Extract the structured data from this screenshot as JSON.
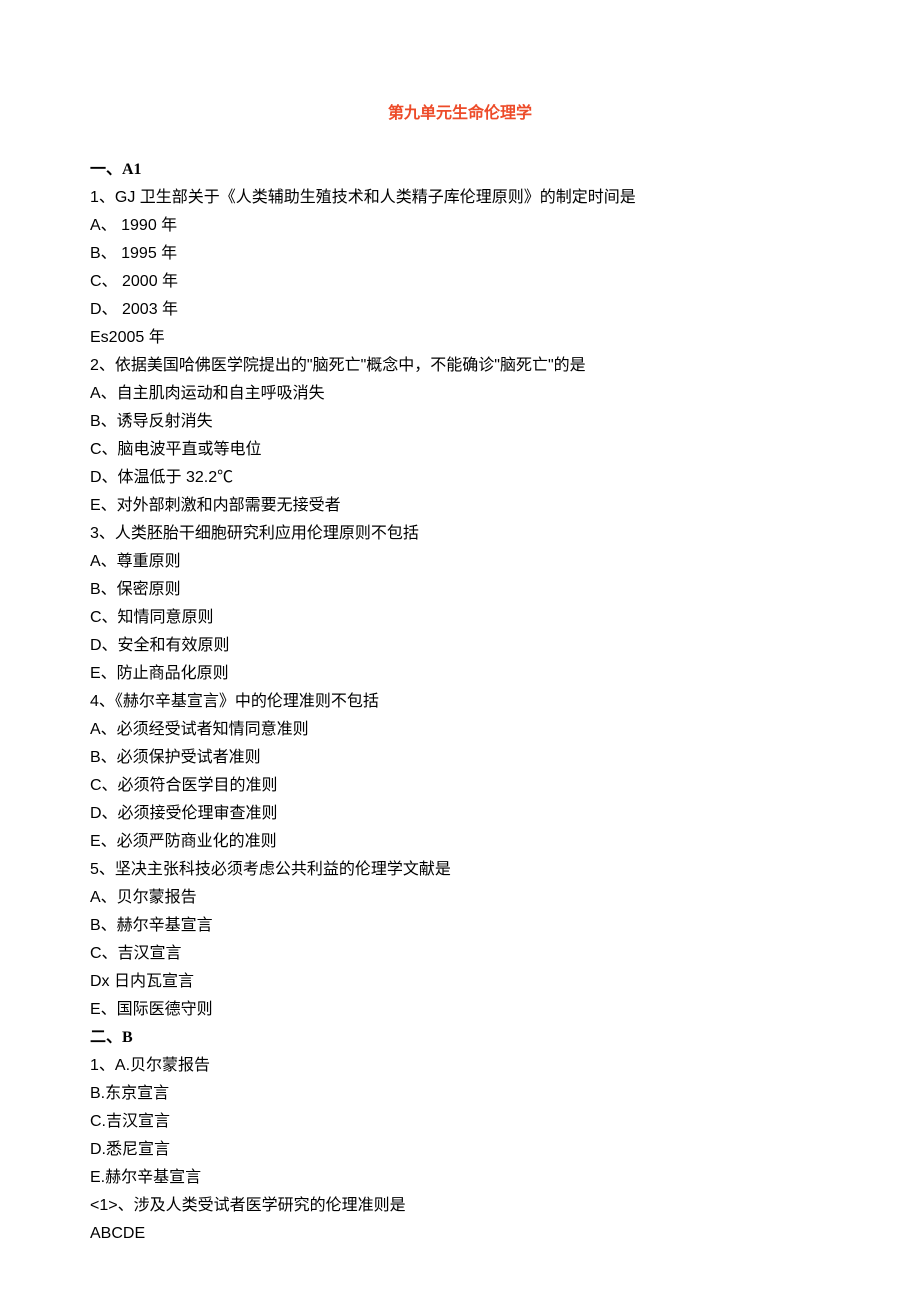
{
  "title": "第九单元生命伦理学",
  "sectionA": {
    "heading": "一、A1",
    "questions": [
      {
        "stem": "1、GJ 卫生部关于《人类辅助生殖技术和人类精子库伦理原则》的制定时间是",
        "options": [
          "A、 1990 年",
          "B、 1995 年",
          "C、 2000 年",
          "D、 2003 年",
          "Es2005 年"
        ]
      },
      {
        "stem": "2、依据美国哈佛医学院提出的\"脑死亡\"概念中，不能确诊\"脑死亡\"的是",
        "options": [
          "A、自主肌肉运动和自主呼吸消失",
          "B、诱导反射消失",
          "C、脑电波平直或等电位",
          "D、体温低于 32.2℃",
          "E、对外部刺激和内部需要无接受者"
        ]
      },
      {
        "stem": "3、人类胚胎干细胞研究利应用伦理原则不包括",
        "options": [
          "A、尊重原则",
          "B、保密原则",
          "C、知情同意原则",
          "D、安全和有效原则",
          "E、防止商品化原则"
        ]
      },
      {
        "stem": "4、《赫尔辛基宣言》中的伦理准则不包括",
        "options": [
          "A、必须经受试者知情同意准则",
          "B、必须保护受试者准则",
          "C、必须符合医学目的准则",
          "D、必须接受伦理审查准则",
          "E、必须严防商业化的准则"
        ]
      },
      {
        "stem": "5、坚决主张科技必须考虑公共利益的伦理学文献是",
        "options": [
          "A、贝尔蒙报告",
          "B、赫尔辛基宣言",
          "C、吉汉宣言",
          "Dx 日内瓦宣言",
          "E、国际医德守则"
        ]
      }
    ]
  },
  "sectionB": {
    "heading": "二、B",
    "shared": {
      "stem": "1、A.贝尔蒙报告",
      "options": [
        "B.东京宣言",
        "C.吉汉宣言",
        "D.悉尼宣言",
        "E.赫尔辛基宣言"
      ]
    },
    "sub": {
      "stem": "<1>、涉及人类受试者医学研究的伦理准则是",
      "options": "ABCDE"
    }
  }
}
